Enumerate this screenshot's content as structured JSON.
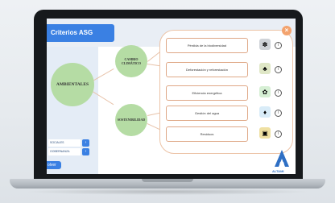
{
  "app": {
    "title": "Criterios ASG"
  },
  "left_nav": {
    "items": [
      {
        "label": "SOCIALES",
        "button": "›"
      },
      {
        "label": "GOBERNANZA",
        "button": "›"
      }
    ],
    "volver": "olver"
  },
  "diagram": {
    "main": "AMBIENTALES",
    "branches": [
      "CAMBIO CLIMÁTICO",
      "SOSTENIBILIDAD"
    ]
  },
  "criteria": [
    {
      "label": "Pérdida de la biodiversidad",
      "icon": "earth-icon",
      "icon_glyph": "✽",
      "icon_color": "#cfd3d8"
    },
    {
      "label": "Deforestación y reforestación",
      "icon": "tree-icon",
      "icon_glyph": "♣",
      "icon_color": "#dfe7c6"
    },
    {
      "label": "Eficiencia energética",
      "icon": "energy-leaf-icon",
      "icon_glyph": "✿",
      "icon_color": "#d6efd4"
    },
    {
      "label": "Gestión del agua",
      "icon": "water-tap-icon",
      "icon_glyph": "♦",
      "icon_color": "#d9ecf8"
    },
    {
      "label": "Residuos",
      "icon": "waste-bin-icon",
      "icon_glyph": "▣",
      "icon_color": "#efe0a2"
    }
  ],
  "info_glyph": "i",
  "close_glyph": "×",
  "brand": {
    "name": "ALTAMI",
    "color": "#2e6fc4"
  }
}
